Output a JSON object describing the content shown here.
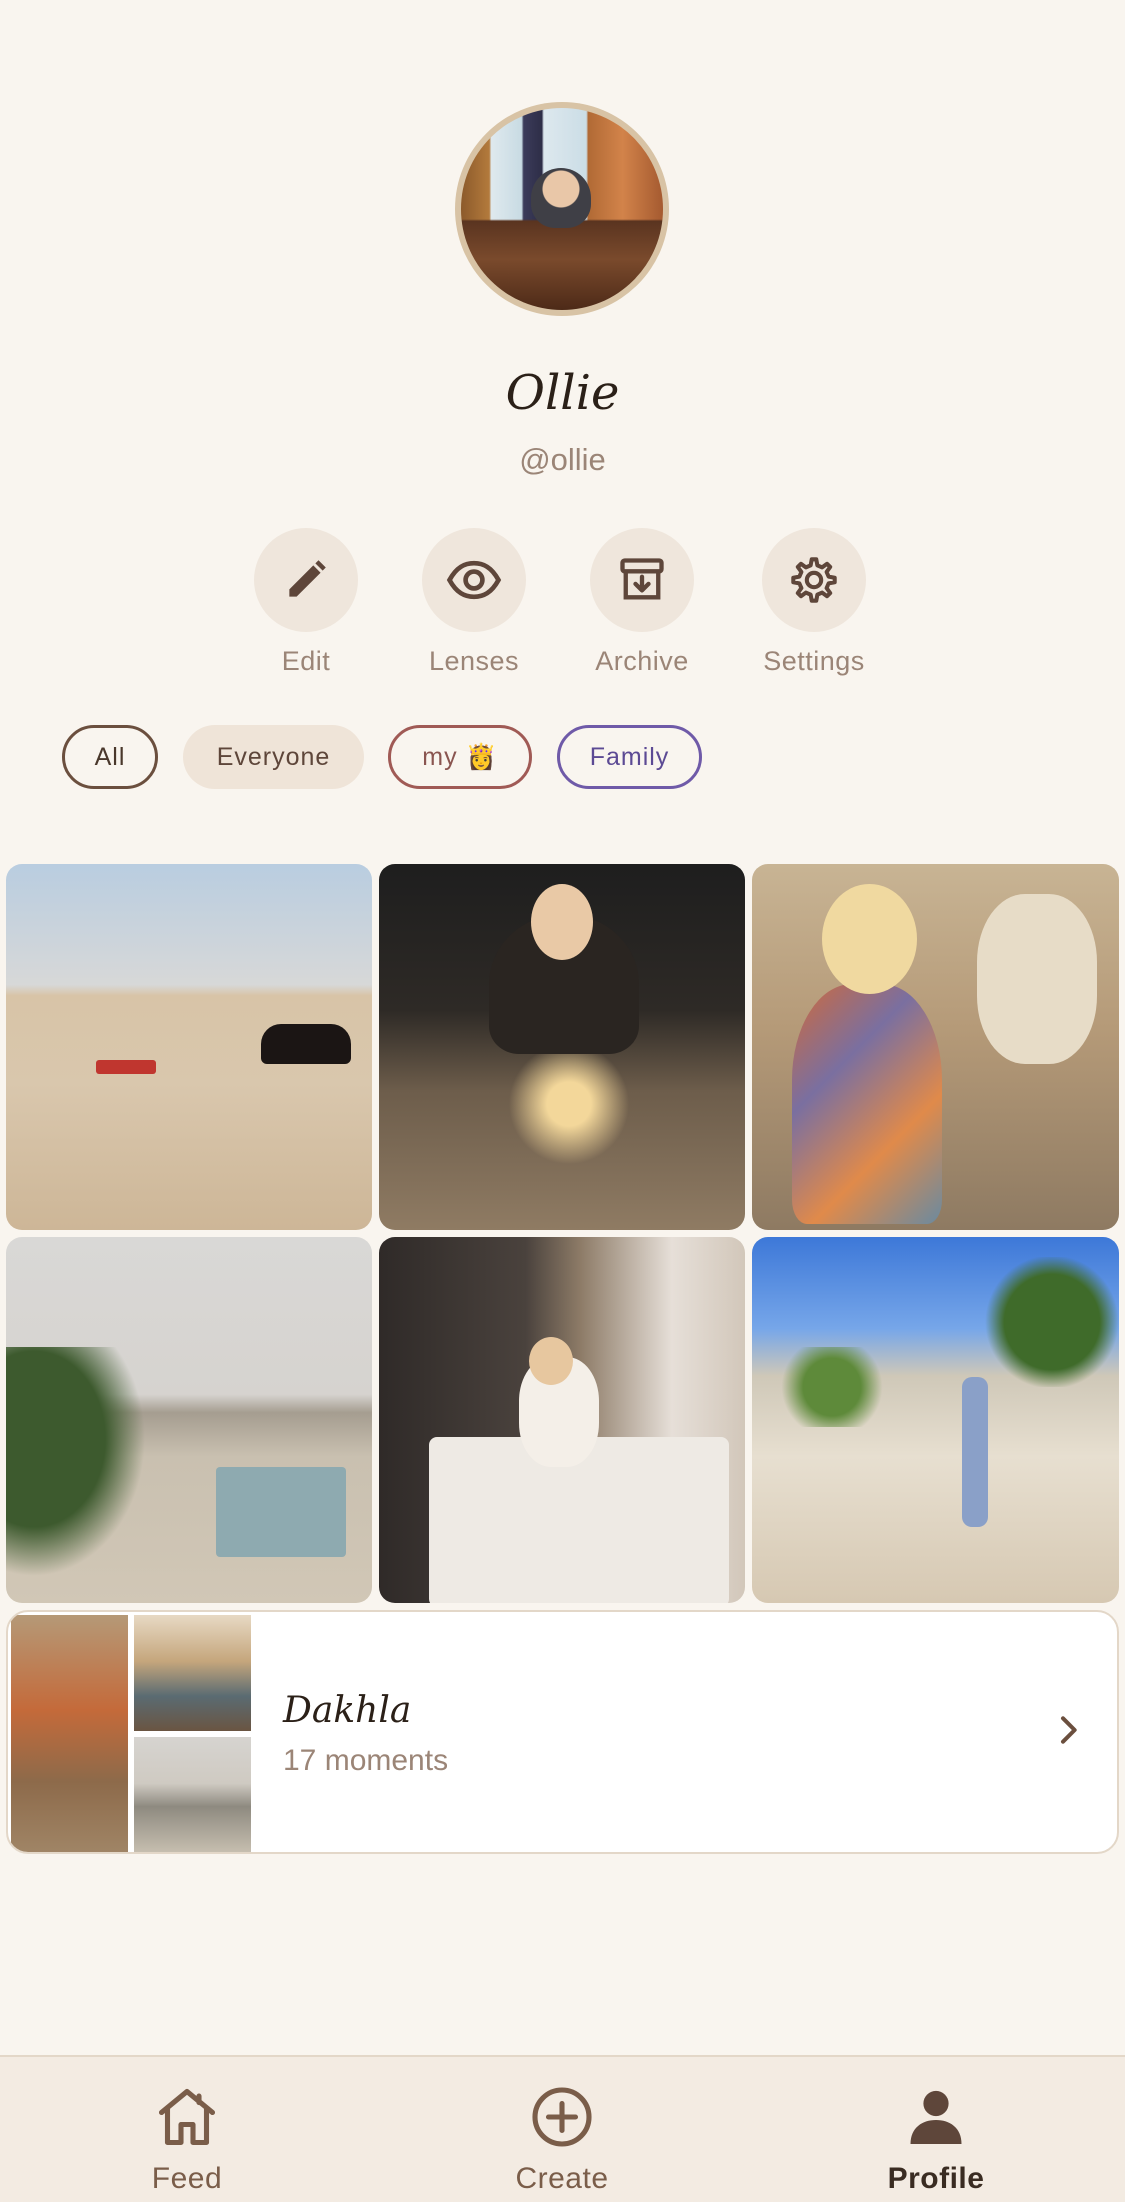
{
  "profile": {
    "name": "Ollie",
    "handle": "@ollie"
  },
  "actions": [
    {
      "label": "Edit",
      "icon": "pencil-icon"
    },
    {
      "label": "Lenses",
      "icon": "eye-icon"
    },
    {
      "label": "Archive",
      "icon": "archive-icon"
    },
    {
      "label": "Settings",
      "icon": "gear-icon"
    }
  ],
  "filters": [
    {
      "label": "All",
      "selected": true
    },
    {
      "label": "Everyone",
      "selected": false
    },
    {
      "label": "my 👸",
      "selected": false
    },
    {
      "label": "Family",
      "selected": false
    }
  ],
  "album": {
    "title": "Dakhla",
    "count": "17 moments"
  },
  "nav": [
    {
      "label": "Feed",
      "icon": "home-icon"
    },
    {
      "label": "Create",
      "icon": "plus-circle-icon"
    },
    {
      "label": "Profile",
      "icon": "person-icon",
      "active": true
    }
  ],
  "colors": {
    "background": "#f9f5ef",
    "accent_brown": "#6b4f3e",
    "chip_red": "#a05a55",
    "chip_purple": "#6f5aa8"
  }
}
